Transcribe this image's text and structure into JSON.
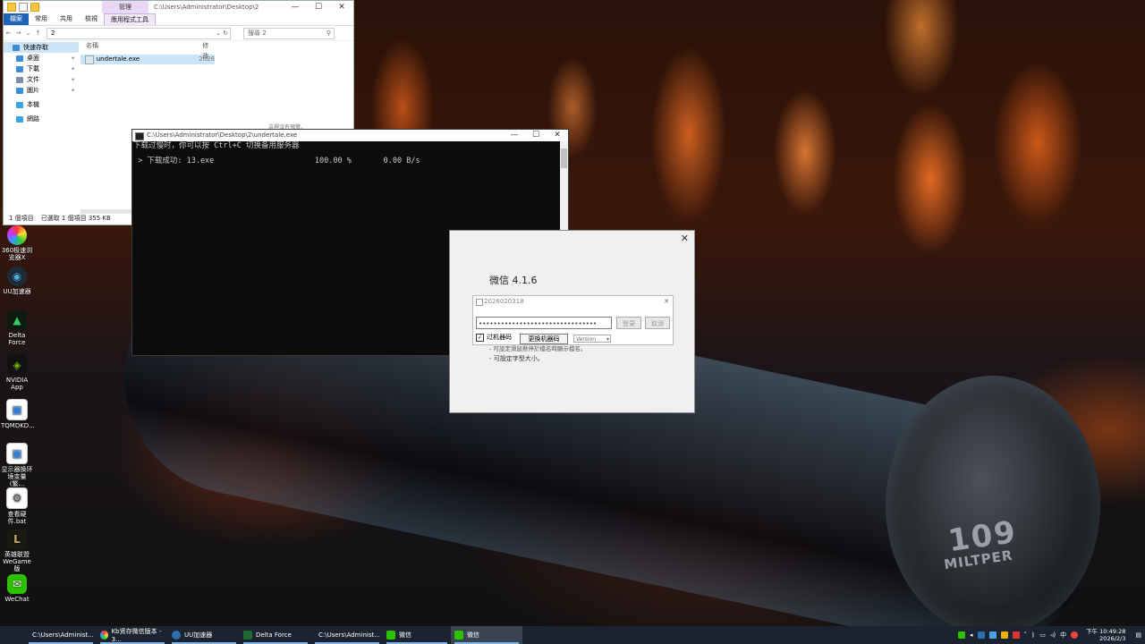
{
  "desktop_icons": [
    {
      "id": "360",
      "label": "360极速浏览器X",
      "color": "#f7a21b",
      "glyph": "◎"
    },
    {
      "id": "uu",
      "label": "UU加速器",
      "color": "#1d2c3b",
      "glyph": "◉"
    },
    {
      "id": "delta",
      "label": "Delta Force",
      "color": "#0f1a12",
      "glyph": "▲"
    },
    {
      "id": "nvidia",
      "label": "NVIDIA App",
      "color": "#111",
      "glyph": "◈"
    },
    {
      "id": "tqm",
      "label": "TQMDKD...",
      "color": "#ffffff",
      "glyph": "▣"
    },
    {
      "id": "sysinfo",
      "label": "显示器换环境变量(繁...",
      "color": "#ffffff",
      "glyph": "▣"
    },
    {
      "id": "bat",
      "label": "查看硬件.bat",
      "color": "#ffffff",
      "glyph": "⚙"
    },
    {
      "id": "lol",
      "label": "英雄联盟WeGame版",
      "color": "#1a1a10",
      "glyph": "L"
    },
    {
      "id": "wechat",
      "label": "WeChat",
      "color": "#2dc100",
      "glyph": "✉"
    }
  ],
  "explorer": {
    "context_tab": "管理",
    "title_path": "C:\\Users\\Administrator\\Desktop\\2",
    "ribbon": [
      "檔案",
      "常用",
      "共用",
      "檢視",
      "應用程式工具"
    ],
    "address": "2",
    "search_placeholder": "搜尋 2",
    "sidebar": [
      {
        "label": "快速存取",
        "icon": "star-icon",
        "color": "#3d8ad9"
      },
      {
        "label": "桌面",
        "icon": "desktop-icon",
        "color": "#3b8fd6"
      },
      {
        "label": "下載",
        "icon": "download-icon",
        "color": "#3b8fd6"
      },
      {
        "label": "文件",
        "icon": "document-icon",
        "color": "#7d8fa8"
      },
      {
        "label": "圖片",
        "icon": "picture-icon",
        "color": "#3b8fd6"
      },
      {
        "label": "本機",
        "icon": "computer-icon",
        "color": "#3aa6dd"
      },
      {
        "label": "網路",
        "icon": "network-icon",
        "color": "#3aa6dd"
      }
    ],
    "col_name": "名稱",
    "col_modified": "修改",
    "file_name": "undertale.exe",
    "file_modified": "2026",
    "status_items": "1 個項目",
    "status_selected": "已選取 1 個項目 355 KB",
    "extra_text": "這裡沒有預覽。"
  },
  "console": {
    "title": "C:\\Users\\Administrator\\Desktop\\2\\undertale.exe",
    "line1": "下载过慢时，你可以按 Ctrl+C 切换备用服务器",
    "line2": " > 下载成功: 13.exe                      100.00 %       0.00 B/s"
  },
  "wechat": {
    "title": "微信 4.1.6",
    "inner_title": "2026020318",
    "password": "••••••••••••••••••••••••••••••••",
    "login_label": "登录",
    "cancel_label": "取消",
    "check_label": "过机器码",
    "change_label": "更换机器码",
    "select_value": "Version",
    "note1": "- 可設定滑鼠懸停於檔名時顯示檔名。",
    "note2": "- 可設定字型大小。"
  },
  "taskbar": {
    "items": [
      {
        "label": "C:\\Users\\Administ...",
        "color": "#f0c24b",
        "active": false
      },
      {
        "label": "Kb贤存微信版本 - 3...",
        "color": "#f7a21b",
        "active": false
      },
      {
        "label": "UU加速器",
        "color": "#2a6fb0",
        "active": false
      },
      {
        "label": "Delta Force",
        "color": "#1d6b32",
        "active": false
      },
      {
        "label": "C:\\Users\\Administ...",
        "color": "#cfcfcf",
        "active": false
      },
      {
        "label": "微信",
        "color": "#2dc100",
        "active": false
      },
      {
        "label": "微信",
        "color": "#2dc100",
        "active": true
      }
    ],
    "ime": "中",
    "time": "下午 10:49:28",
    "date": "2026/2/3"
  },
  "wallpaper": {
    "cap_text": "109",
    "cap_sub": "MILTPER"
  }
}
